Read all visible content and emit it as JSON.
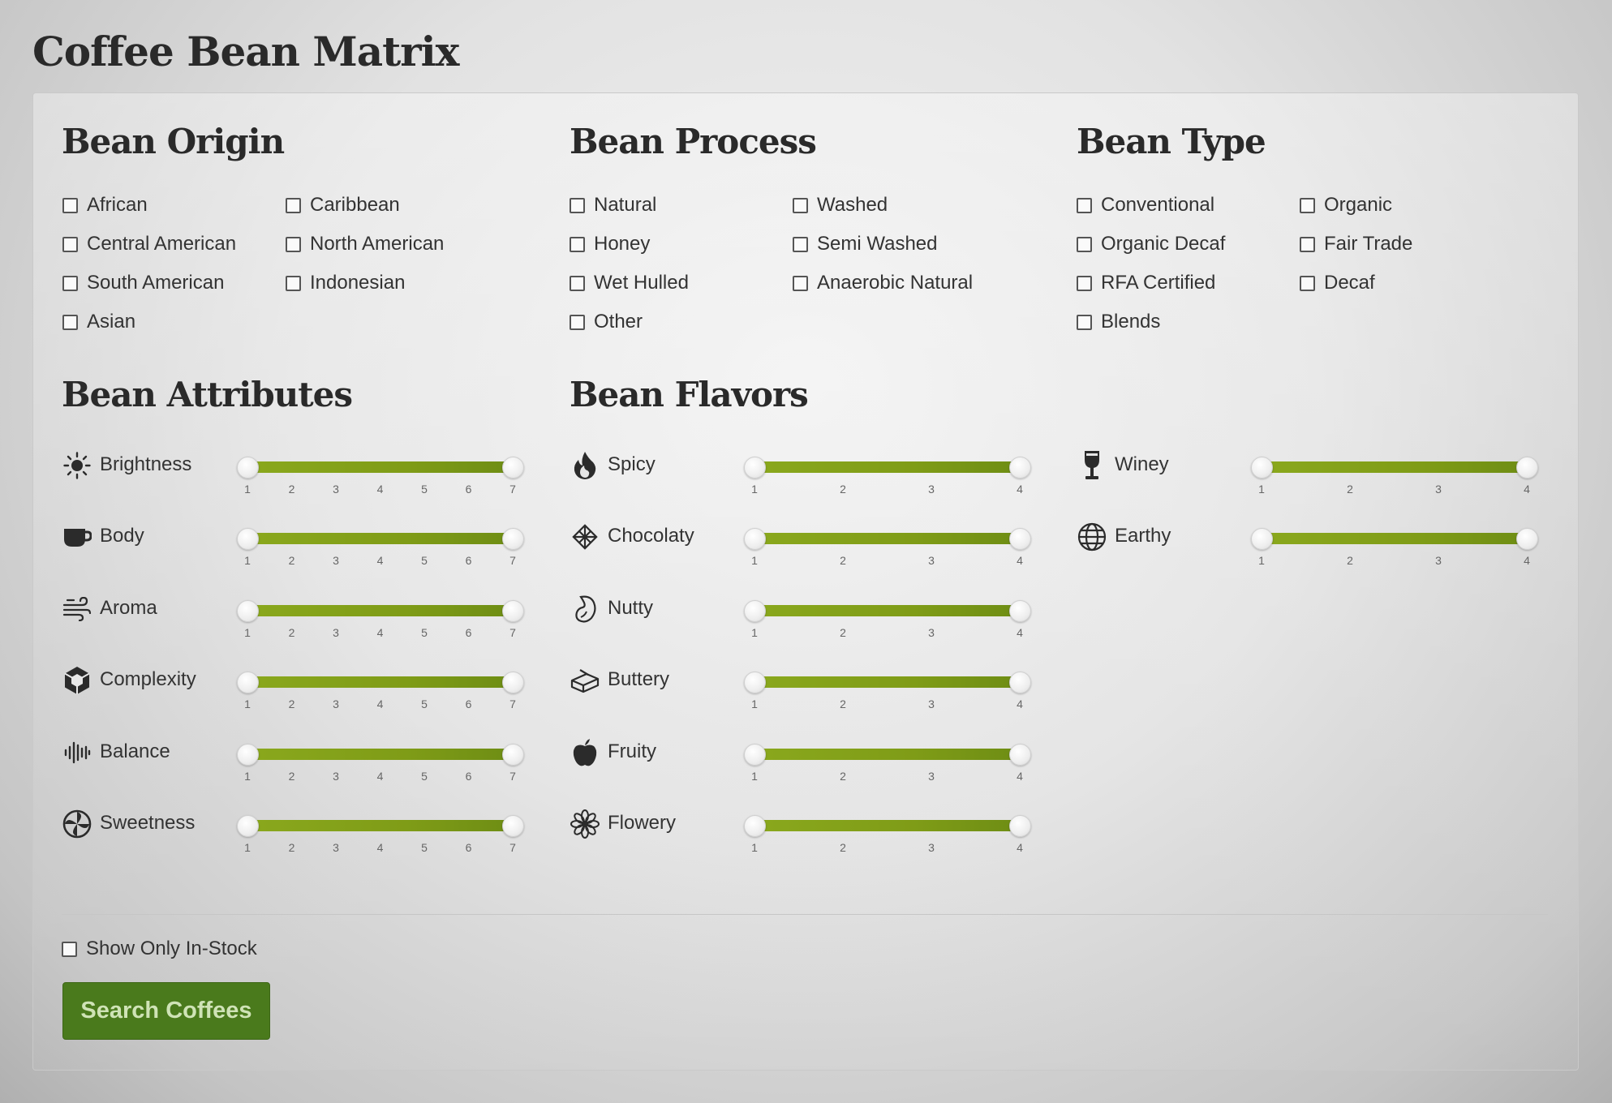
{
  "title": "Coffee Bean Matrix",
  "accent_color": "#7f9c17",
  "button_color": "#4a7a1c",
  "origin": {
    "title": "Bean Origin",
    "options": [
      "African",
      "Caribbean",
      "Central American",
      "North American",
      "South American",
      "Indonesian",
      "Asian"
    ]
  },
  "process": {
    "title": "Bean Process",
    "options": [
      "Natural",
      "Washed",
      "Honey",
      "Semi Washed",
      "Wet Hulled",
      "Anaerobic Natural",
      "Other"
    ]
  },
  "type": {
    "title": "Bean Type",
    "options": [
      "Conventional",
      "Organic",
      "Organic Decaf",
      "Fair Trade",
      "RFA Certified",
      "Decaf",
      "Blends"
    ]
  },
  "attributes": {
    "title": "Bean Attributes",
    "ticks": [
      "1",
      "2",
      "3",
      "4",
      "5",
      "6",
      "7"
    ],
    "items": [
      {
        "label": "Brightness",
        "icon": "sun-icon",
        "range": [
          1,
          7
        ]
      },
      {
        "label": "Body",
        "icon": "cup-icon",
        "range": [
          1,
          7
        ]
      },
      {
        "label": "Aroma",
        "icon": "wind-icon",
        "range": [
          1,
          7
        ]
      },
      {
        "label": "Complexity",
        "icon": "cube-icon",
        "range": [
          1,
          7
        ]
      },
      {
        "label": "Balance",
        "icon": "waveform-icon",
        "range": [
          1,
          7
        ]
      },
      {
        "label": "Sweetness",
        "icon": "candy-icon",
        "range": [
          1,
          7
        ]
      }
    ]
  },
  "flavors": {
    "title": "Bean Flavors",
    "ticks": [
      "1",
      "2",
      "3",
      "4"
    ],
    "items": [
      {
        "label": "Spicy",
        "icon": "flame-icon",
        "range": [
          1,
          4
        ]
      },
      {
        "label": "Chocolaty",
        "icon": "chocolate-icon",
        "range": [
          1,
          4
        ]
      },
      {
        "label": "Nutty",
        "icon": "bean-icon",
        "range": [
          1,
          4
        ]
      },
      {
        "label": "Buttery",
        "icon": "butter-icon",
        "range": [
          1,
          4
        ]
      },
      {
        "label": "Fruity",
        "icon": "apple-icon",
        "range": [
          1,
          4
        ]
      },
      {
        "label": "Flowery",
        "icon": "flower-icon",
        "range": [
          1,
          4
        ]
      },
      {
        "label": "Winey",
        "icon": "wine-glass-icon",
        "range": [
          1,
          4
        ]
      },
      {
        "label": "Earthy",
        "icon": "globe-icon",
        "range": [
          1,
          4
        ]
      }
    ]
  },
  "instock_label": "Show Only In-Stock",
  "search_button": "Search Coffees"
}
